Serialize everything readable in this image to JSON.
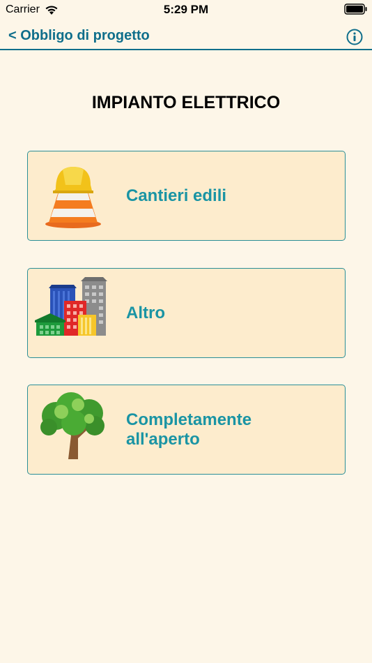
{
  "status_bar": {
    "carrier": "Carrier",
    "time": "5:29 PM",
    "wifi_icon": "wifi-icon",
    "battery_icon": "battery-icon"
  },
  "nav": {
    "back_label": "< Obbligo di progetto",
    "info_icon": "info-icon",
    "accent_color": "#0f6e8b"
  },
  "page": {
    "title": "IMPIANTO ELETTRICO"
  },
  "cards": [
    {
      "label": "Cantieri edili",
      "icon": "traffic-cone-hardhat-icon"
    },
    {
      "label": "Altro",
      "icon": "buildings-icon"
    },
    {
      "label_line1": "Completamente",
      "label_line2": "all'aperto",
      "icon": "tree-icon"
    }
  ],
  "colors": {
    "background": "#fdf6e8",
    "card_background": "#fdeccd",
    "card_border": "#2a8e97",
    "card_text": "#1a94a4"
  }
}
